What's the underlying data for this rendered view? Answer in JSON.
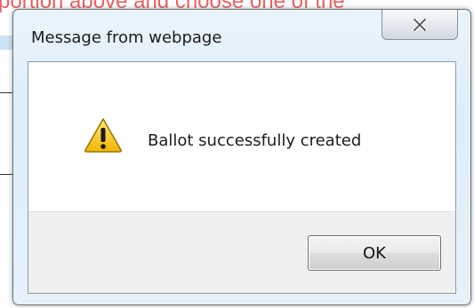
{
  "background": {
    "partial_text": "portion above and choose one of the"
  },
  "dialog": {
    "title": "Message from webpage",
    "message": "Ballot successfully created",
    "ok_label": "OK",
    "icon": "warning-icon",
    "close_icon": "close-icon"
  },
  "colors": {
    "background_text": "#e8474a",
    "titlebar": "#dfeefa",
    "warning_fill": "#f5c518",
    "button_area": "#f0f0f0"
  }
}
